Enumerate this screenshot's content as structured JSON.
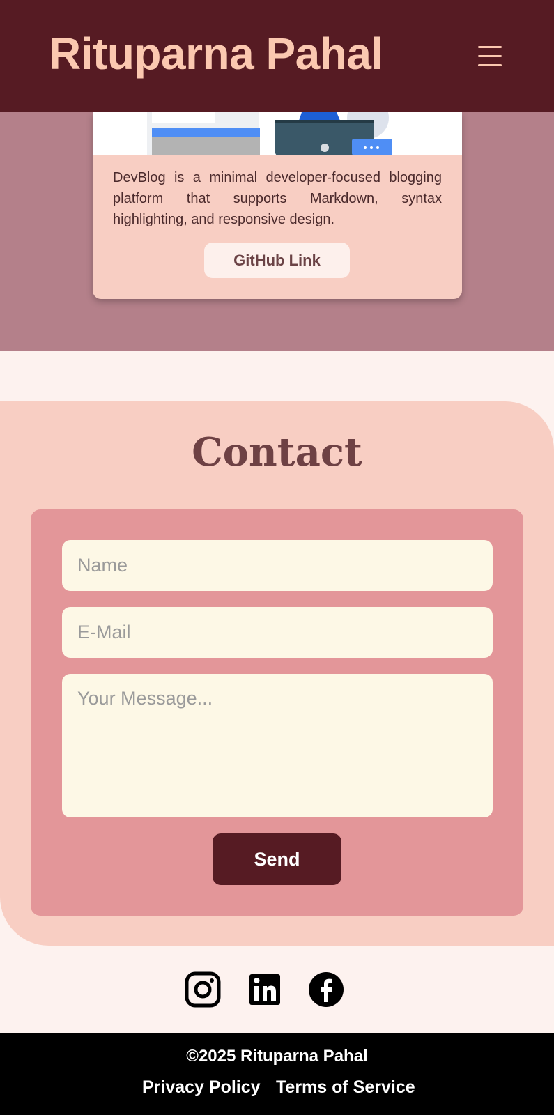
{
  "header": {
    "title": "Rituparna Pahal",
    "menu_icon": "hamburger-menu-icon"
  },
  "project": {
    "description": "DevBlog is a minimal developer-focused blogging platform that supports Markdown, syntax highlighting, and responsive design.",
    "github_label": "GitHub Link"
  },
  "contact": {
    "title": "Contact",
    "name_placeholder": "Name",
    "email_placeholder": "E-Mail",
    "message_placeholder": "Your Message...",
    "send_label": "Send"
  },
  "social": {
    "icons": [
      "instagram-icon",
      "linkedin-icon",
      "facebook-icon"
    ]
  },
  "footer": {
    "copyright": "©2025 Rituparna Pahal",
    "privacy_label": "Privacy Policy",
    "terms_label": "Terms of Service"
  },
  "colors": {
    "header_bg": "#561b23",
    "title_color": "#fbc8b0",
    "projects_bg": "#b4808a",
    "card_bg": "#f8cec3",
    "form_bg": "#e39699",
    "input_bg": "#fdf8e6",
    "page_bg": "#fdf2ef",
    "footer_bg": "#000000"
  }
}
